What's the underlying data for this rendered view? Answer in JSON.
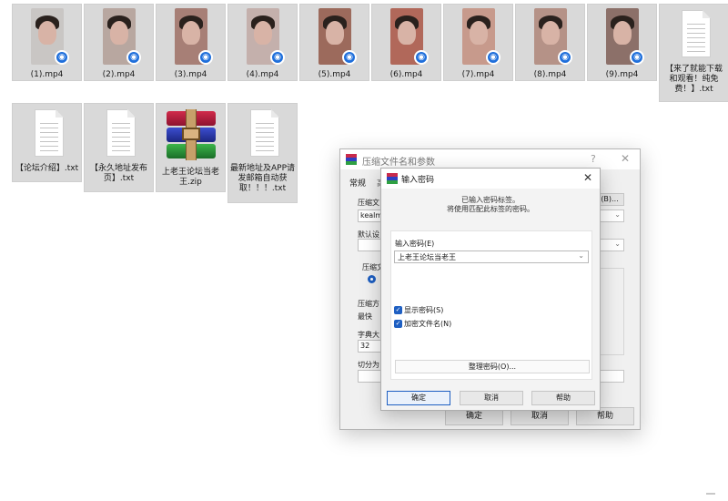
{
  "files": [
    {
      "name": "(1).mp4",
      "type": "video",
      "bg": "#c9c6c4"
    },
    {
      "name": "(2).mp4",
      "type": "video",
      "bg": "#b8a7a0"
    },
    {
      "name": "(3).mp4",
      "type": "video",
      "bg": "#a77f76"
    },
    {
      "name": "(4).mp4",
      "type": "video",
      "bg": "#c4b0ac"
    },
    {
      "name": "(5).mp4",
      "type": "video",
      "bg": "#9c6a5c"
    },
    {
      "name": "(6).mp4",
      "type": "video",
      "bg": "#b1685a"
    },
    {
      "name": "(7).mp4",
      "type": "video",
      "bg": "#c79a8c"
    },
    {
      "name": "(8).mp4",
      "type": "video",
      "bg": "#b59287"
    },
    {
      "name": "(9).mp4",
      "type": "video",
      "bg": "#8c7069"
    },
    {
      "name": "【来了就能下载和观看！纯免费！】.txt",
      "type": "text"
    },
    {
      "name": "【论坛介绍】.txt",
      "type": "text"
    },
    {
      "name": "【永久地址发布页】.txt",
      "type": "text"
    },
    {
      "name": "上老王论坛当老王.zip",
      "type": "archive"
    },
    {
      "name": "最新地址及APP请发邮箱自动获取！！！.txt",
      "type": "text"
    }
  ],
  "back_dialog": {
    "title": "压缩文件名和参数",
    "help": "?",
    "close": "✕",
    "tab_general": "常规",
    "tab_advanced": "高",
    "archive_name_label": "压缩文",
    "archive_name_value": "kealme",
    "browse_button": "(B)...",
    "default_settings_label": "默认设",
    "format_label": "压缩文",
    "method_label": "压缩方",
    "method_value": "最快",
    "dict_label": "字典大",
    "dict_value": "32",
    "split_label": "切分为",
    "ok": "确定",
    "cancel": "取消",
    "help_button": "帮助"
  },
  "password_dialog": {
    "title": "输入密码",
    "close": "✕",
    "info_line1": "已输入密码标签。",
    "info_line2": "将使用匹配此标签的密码。",
    "password_label": "输入密码(E)",
    "password_value": "上老王论坛当老王",
    "show_password_label": "显示密码(S)",
    "show_password_checked": true,
    "encrypt_names_label": "加密文件名(N)",
    "encrypt_names_checked": true,
    "organize_button": "整理密码(O)...",
    "ok": "确定",
    "cancel": "取消",
    "help": "帮助"
  }
}
